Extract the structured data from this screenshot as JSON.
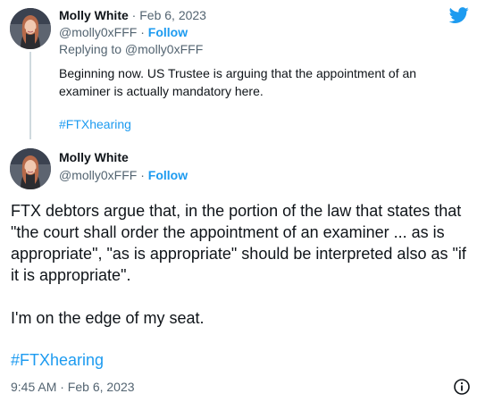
{
  "parent_tweet": {
    "author_name": "Molly White",
    "separator": "·",
    "date": "Feb 6, 2023",
    "handle": "@molly0xFFF",
    "follow_label": "Follow",
    "replying_to": "Replying to @molly0xFFF",
    "text": "Beginning now. US Trustee is arguing that the appointment of an examiner is actually mandatory here.",
    "hashtag": "#FTXhearing"
  },
  "main_tweet": {
    "author_name": "Molly White",
    "handle": "@molly0xFFF",
    "separator": "·",
    "follow_label": "Follow",
    "text_paragraph_1": "FTX debtors argue that, in the portion of the law that states that \"the court shall order the appointment of an examiner ... as is appropriate\", \"as is appropriate\" should be interpreted also as \"if it is appropriate\".",
    "text_paragraph_2": "I'm on the edge of my seat.",
    "hashtag": "#FTXhearing",
    "timestamp": "9:45 AM · Feb 6, 2023"
  },
  "icons": {
    "brand": "twitter-bird-icon",
    "info": "info-icon"
  },
  "colors": {
    "accent": "#1d9bf0",
    "secondary_text": "#536471",
    "primary_text": "#0f1419",
    "thread_line": "#cfd9de"
  }
}
